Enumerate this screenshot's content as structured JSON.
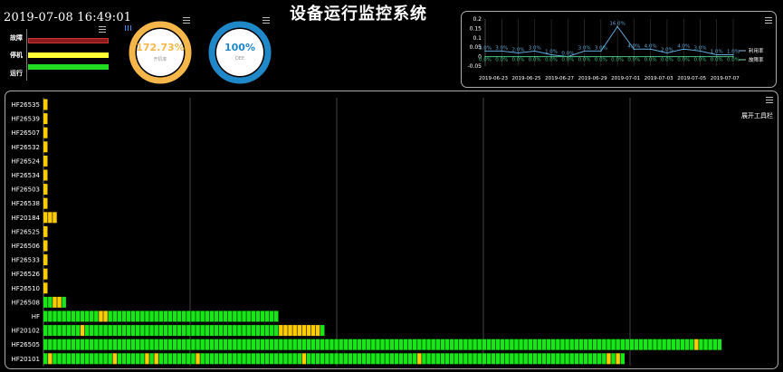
{
  "header": {
    "datetime": "2019-07-08 16:49:01",
    "title": "设备运行监控系统"
  },
  "legend": {
    "items": [
      {
        "label": "故障",
        "color": "#8b1a1a"
      },
      {
        "label": "停机",
        "color": "#ffff33"
      },
      {
        "label": "运行",
        "color": "#22dd22"
      }
    ]
  },
  "gauges": [
    {
      "value": "172.73%",
      "label": "开机率",
      "color": "#f5b74a",
      "fraction": 1.0
    },
    {
      "value": "100%",
      "label": "OEE",
      "color": "#1e88c8",
      "fraction": 1.0
    }
  ],
  "toolbar": {
    "expand_label": "展开工具栏"
  },
  "colors": {
    "run": "#17e617",
    "stop": "#ffcc00",
    "fault": "#8b1a1a",
    "grid": "#555555"
  },
  "chart_data": [
    {
      "type": "line",
      "x": [
        "2019-06-23",
        "2019-06-24",
        "2019-06-25",
        "2019-06-26",
        "2019-06-27",
        "2019-06-28",
        "2019-06-29",
        "2019-06-30",
        "2019-07-01",
        "2019-07-02",
        "2019-07-03",
        "2019-07-04",
        "2019-07-05",
        "2019-07-06",
        "2019-07-07",
        "2019-07-08"
      ],
      "xticks": [
        "2019-06-23",
        "2019-06-25",
        "2019-06-27",
        "2019-06-29",
        "2019-07-01",
        "2019-07-03",
        "2019-07-05",
        "2019-07-07"
      ],
      "ylim": [
        -0.05,
        0.2
      ],
      "yticks": [
        "0.2",
        "0.15",
        "0.1",
        "0.05",
        "0",
        "-0.05"
      ],
      "series": [
        {
          "name": "利用率",
          "color": "#5fa8d6",
          "values": [
            0.03,
            0.03,
            0.02,
            0.03,
            0.01,
            0.0,
            0.03,
            0.03,
            0.16,
            0.04,
            0.04,
            0.02,
            0.04,
            0.03,
            0.01,
            0.01
          ],
          "labels": [
            "3.0%",
            "3.0%",
            "2.0%",
            "3.0%",
            "1.0%",
            "0.0%",
            "3.0%",
            "3.0%",
            "16.0%",
            "4.0%",
            "4.0%",
            "2.0%",
            "4.0%",
            "3.0%",
            "1.0%",
            "1.0%"
          ]
        },
        {
          "name": "故障率",
          "color": "#3fbf7f",
          "values": [
            0,
            0,
            0,
            0,
            0,
            0,
            0,
            0,
            0,
            0,
            0,
            0,
            0,
            0,
            0,
            0
          ],
          "labels": [
            "0.0%",
            "0.0%",
            "0.0%",
            "0.0%",
            "0.0%",
            "0.0%",
            "0.0%",
            "0.0%",
            "0.0%",
            "0.0%",
            "0.0%",
            "0.0%",
            "0.0%",
            "0.0%",
            "0.0%",
            "0.0%"
          ]
        }
      ]
    },
    {
      "type": "bar",
      "title": "",
      "xlabel": "",
      "ylabel": "",
      "categories": [
        "HF26535",
        "HF26539",
        "HF26507",
        "HF26532",
        "HF26524",
        "HF26534",
        "HF26503",
        "HF26538",
        "HF20184",
        "HF26525",
        "HF26506",
        "HF26533",
        "HF26526",
        "HF26510",
        "HF26508",
        "HF",
        "HF20102",
        "HF26505",
        "HF20101"
      ],
      "segments": [
        [
          "S"
        ],
        [
          "S"
        ],
        [
          "S"
        ],
        [
          "S"
        ],
        [
          "S"
        ],
        [
          "S"
        ],
        [
          "S"
        ],
        [
          "S"
        ],
        [
          "S",
          "S",
          "S"
        ],
        [
          "S"
        ],
        [
          "S"
        ],
        [
          "S"
        ],
        [
          "S"
        ],
        [
          "S"
        ],
        [
          "R",
          "R",
          "S",
          "S",
          "R"
        ],
        [
          "R",
          "R",
          "R",
          "R",
          "R",
          "R",
          "R",
          "R",
          "R",
          "R",
          "R",
          "R",
          "S",
          "S",
          "R",
          "R",
          "R",
          "R",
          "R",
          "R",
          "R",
          "R",
          "R",
          "R",
          "R",
          "R",
          "R",
          "R",
          "R",
          "R",
          "R",
          "R",
          "R",
          "R",
          "R",
          "R",
          "R",
          "R",
          "R",
          "R",
          "R",
          "R",
          "R",
          "R",
          "R",
          "R",
          "R",
          "R",
          "R",
          "R",
          "R"
        ],
        [
          "R",
          "R",
          "R",
          "R",
          "R",
          "R",
          "R",
          "R",
          "S",
          "R",
          "R",
          "R",
          "R",
          "R",
          "R",
          "R",
          "R",
          "R",
          "R",
          "R",
          "R",
          "R",
          "R",
          "R",
          "R",
          "R",
          "R",
          "R",
          "R",
          "R",
          "R",
          "R",
          "R",
          "R",
          "R",
          "R",
          "R",
          "R",
          "R",
          "R",
          "R",
          "R",
          "R",
          "R",
          "R",
          "R",
          "R",
          "R",
          "R",
          "R",
          "R",
          "S",
          "S",
          "S",
          "S",
          "S",
          "S",
          "S",
          "S",
          "S",
          "R"
        ],
        [
          "R",
          "R",
          "R",
          "R",
          "R",
          "R",
          "R",
          "R",
          "R",
          "R",
          "R",
          "R",
          "R",
          "R",
          "R",
          "R",
          "R",
          "R",
          "R",
          "R",
          "R",
          "R",
          "R",
          "R",
          "R",
          "R",
          "R",
          "R",
          "R",
          "R",
          "R",
          "R",
          "R",
          "R",
          "R",
          "R",
          "R",
          "R",
          "R",
          "R",
          "R",
          "R",
          "R",
          "R",
          "R",
          "R",
          "R",
          "R",
          "R",
          "R",
          "R",
          "R",
          "R",
          "R",
          "R",
          "R",
          "R",
          "R",
          "R",
          "R",
          "R",
          "R",
          "R",
          "R",
          "R",
          "R",
          "R",
          "R",
          "R",
          "R",
          "R",
          "R",
          "R",
          "R",
          "R",
          "R",
          "R",
          "R",
          "R",
          "R",
          "R",
          "R",
          "R",
          "R",
          "R",
          "R",
          "R",
          "R",
          "R",
          "R",
          "R",
          "R",
          "R",
          "R",
          "R",
          "R",
          "R",
          "R",
          "R",
          "R",
          "R",
          "R",
          "R",
          "R",
          "R",
          "R",
          "R",
          "R",
          "R",
          "R",
          "R",
          "R",
          "R",
          "R",
          "R",
          "R",
          "R",
          "R",
          "R",
          "R",
          "R",
          "R",
          "R",
          "R",
          "R",
          "R",
          "R",
          "R",
          "R",
          "R",
          "R",
          "R",
          "R",
          "R",
          "R",
          "R",
          "R",
          "R",
          "R",
          "R",
          "R",
          "S",
          "R",
          "R",
          "R",
          "R",
          "R"
        ],
        [
          "R",
          "S",
          "R",
          "R",
          "R",
          "R",
          "R",
          "R",
          "R",
          "R",
          "R",
          "R",
          "R",
          "R",
          "R",
          "S",
          "R",
          "R",
          "R",
          "R",
          "R",
          "R",
          "S",
          "R",
          "S",
          "R",
          "R",
          "R",
          "R",
          "R",
          "R",
          "R",
          "R",
          "S",
          "R",
          "R",
          "R",
          "R",
          "R",
          "R",
          "R",
          "R",
          "R",
          "R",
          "R",
          "R",
          "R",
          "R",
          "R",
          "R",
          "R",
          "R",
          "R",
          "R",
          "R",
          "R",
          "S",
          "R",
          "R",
          "R",
          "R",
          "R",
          "R",
          "R",
          "R",
          "R",
          "R",
          "R",
          "R",
          "R",
          "R",
          "R",
          "R",
          "R",
          "R",
          "R",
          "R",
          "R",
          "R",
          "R",
          "R",
          "S",
          "R",
          "R",
          "R",
          "R",
          "R",
          "R",
          "R",
          "R",
          "R",
          "R",
          "R",
          "R",
          "R",
          "R",
          "R",
          "R",
          "R",
          "R",
          "R",
          "R",
          "R",
          "R",
          "R",
          "R",
          "R",
          "R",
          "R",
          "R",
          "R",
          "R",
          "R",
          "R",
          "R",
          "R",
          "R",
          "R",
          "R",
          "R",
          "R",
          "R",
          "S",
          "R",
          "S",
          "R"
        ]
      ],
      "gridlines": 4,
      "legend": "none"
    }
  ]
}
